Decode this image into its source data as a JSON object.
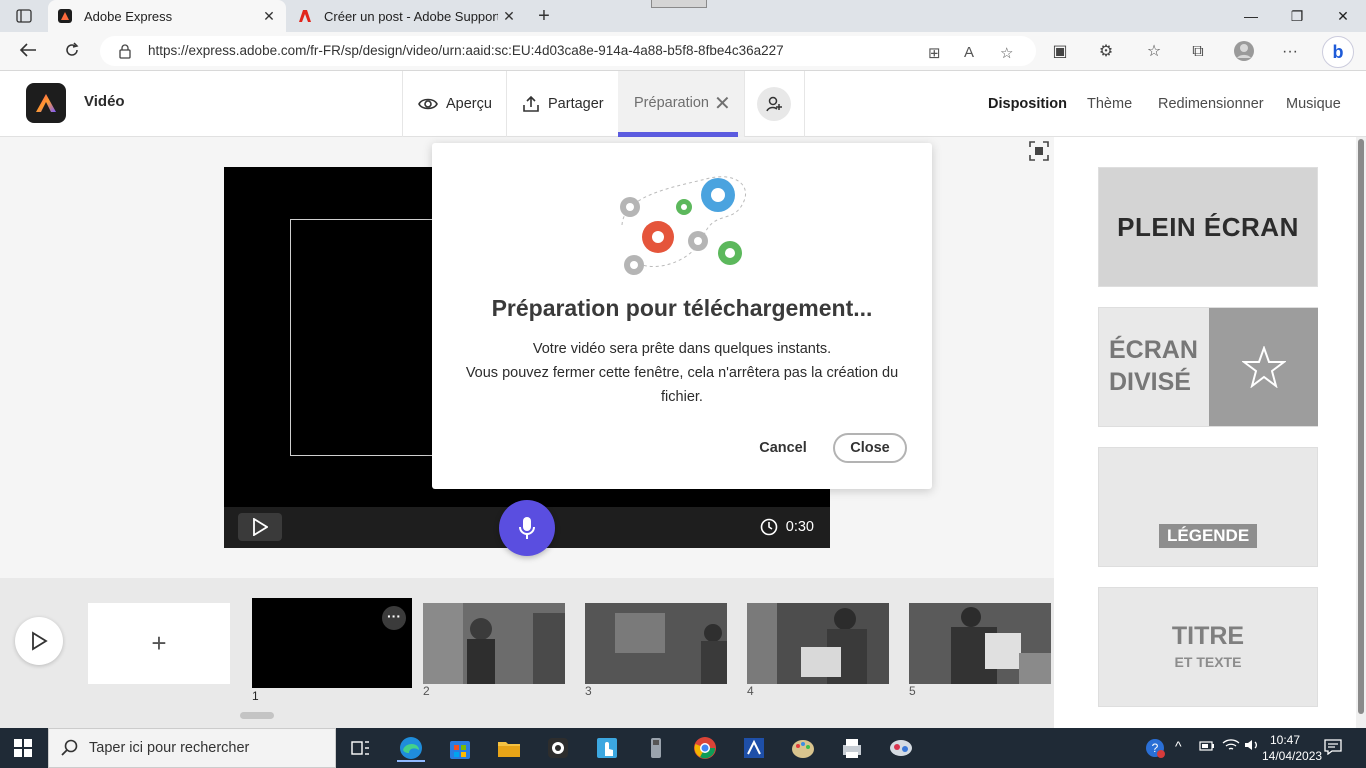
{
  "browser": {
    "tabs": [
      {
        "title": "Adobe Express",
        "active": true
      },
      {
        "title": "Créer un post - Adobe Support C",
        "active": false
      }
    ],
    "url": "https://express.adobe.com/fr-FR/sp/design/video/urn:aaid:sc:EU:4d03ca8e-914a-4a88-b5f8-8fbe4c36a227"
  },
  "app": {
    "title": "Vidéo",
    "header": {
      "preview_label": "Aperçu",
      "share_label": "Partager",
      "preparation_label": "Préparation",
      "right_links": [
        "Disposition",
        "Thème",
        "Redimensionner",
        "Musique"
      ]
    }
  },
  "player": {
    "duration": "0:30"
  },
  "modal": {
    "title": "Préparation pour téléchargement...",
    "line1": "Votre vidéo sera prête dans quelques instants.",
    "line2": "Vous pouvez fermer cette fenêtre, cela n'arrêtera pas la création du fichier.",
    "cancel_label": "Cancel",
    "close_label": "Close"
  },
  "layouts": {
    "full": "PLEIN ÉCRAN",
    "split_line1": "ÉCRAN",
    "split_line2": "DIVISÉ",
    "caption": "LÉGENDE",
    "title_big": "TITRE",
    "title_small": "ET TEXTE"
  },
  "timeline": {
    "add_label": "+",
    "scene_numbers": [
      "1",
      "2",
      "3",
      "4",
      "5"
    ],
    "more_label": "···"
  },
  "taskbar": {
    "search_placeholder": "Taper ici pour rechercher",
    "time": "10:47",
    "date": "14/04/2023"
  },
  "colors": {
    "accent": "#5c5ce0",
    "mic": "#5a4ee0"
  }
}
